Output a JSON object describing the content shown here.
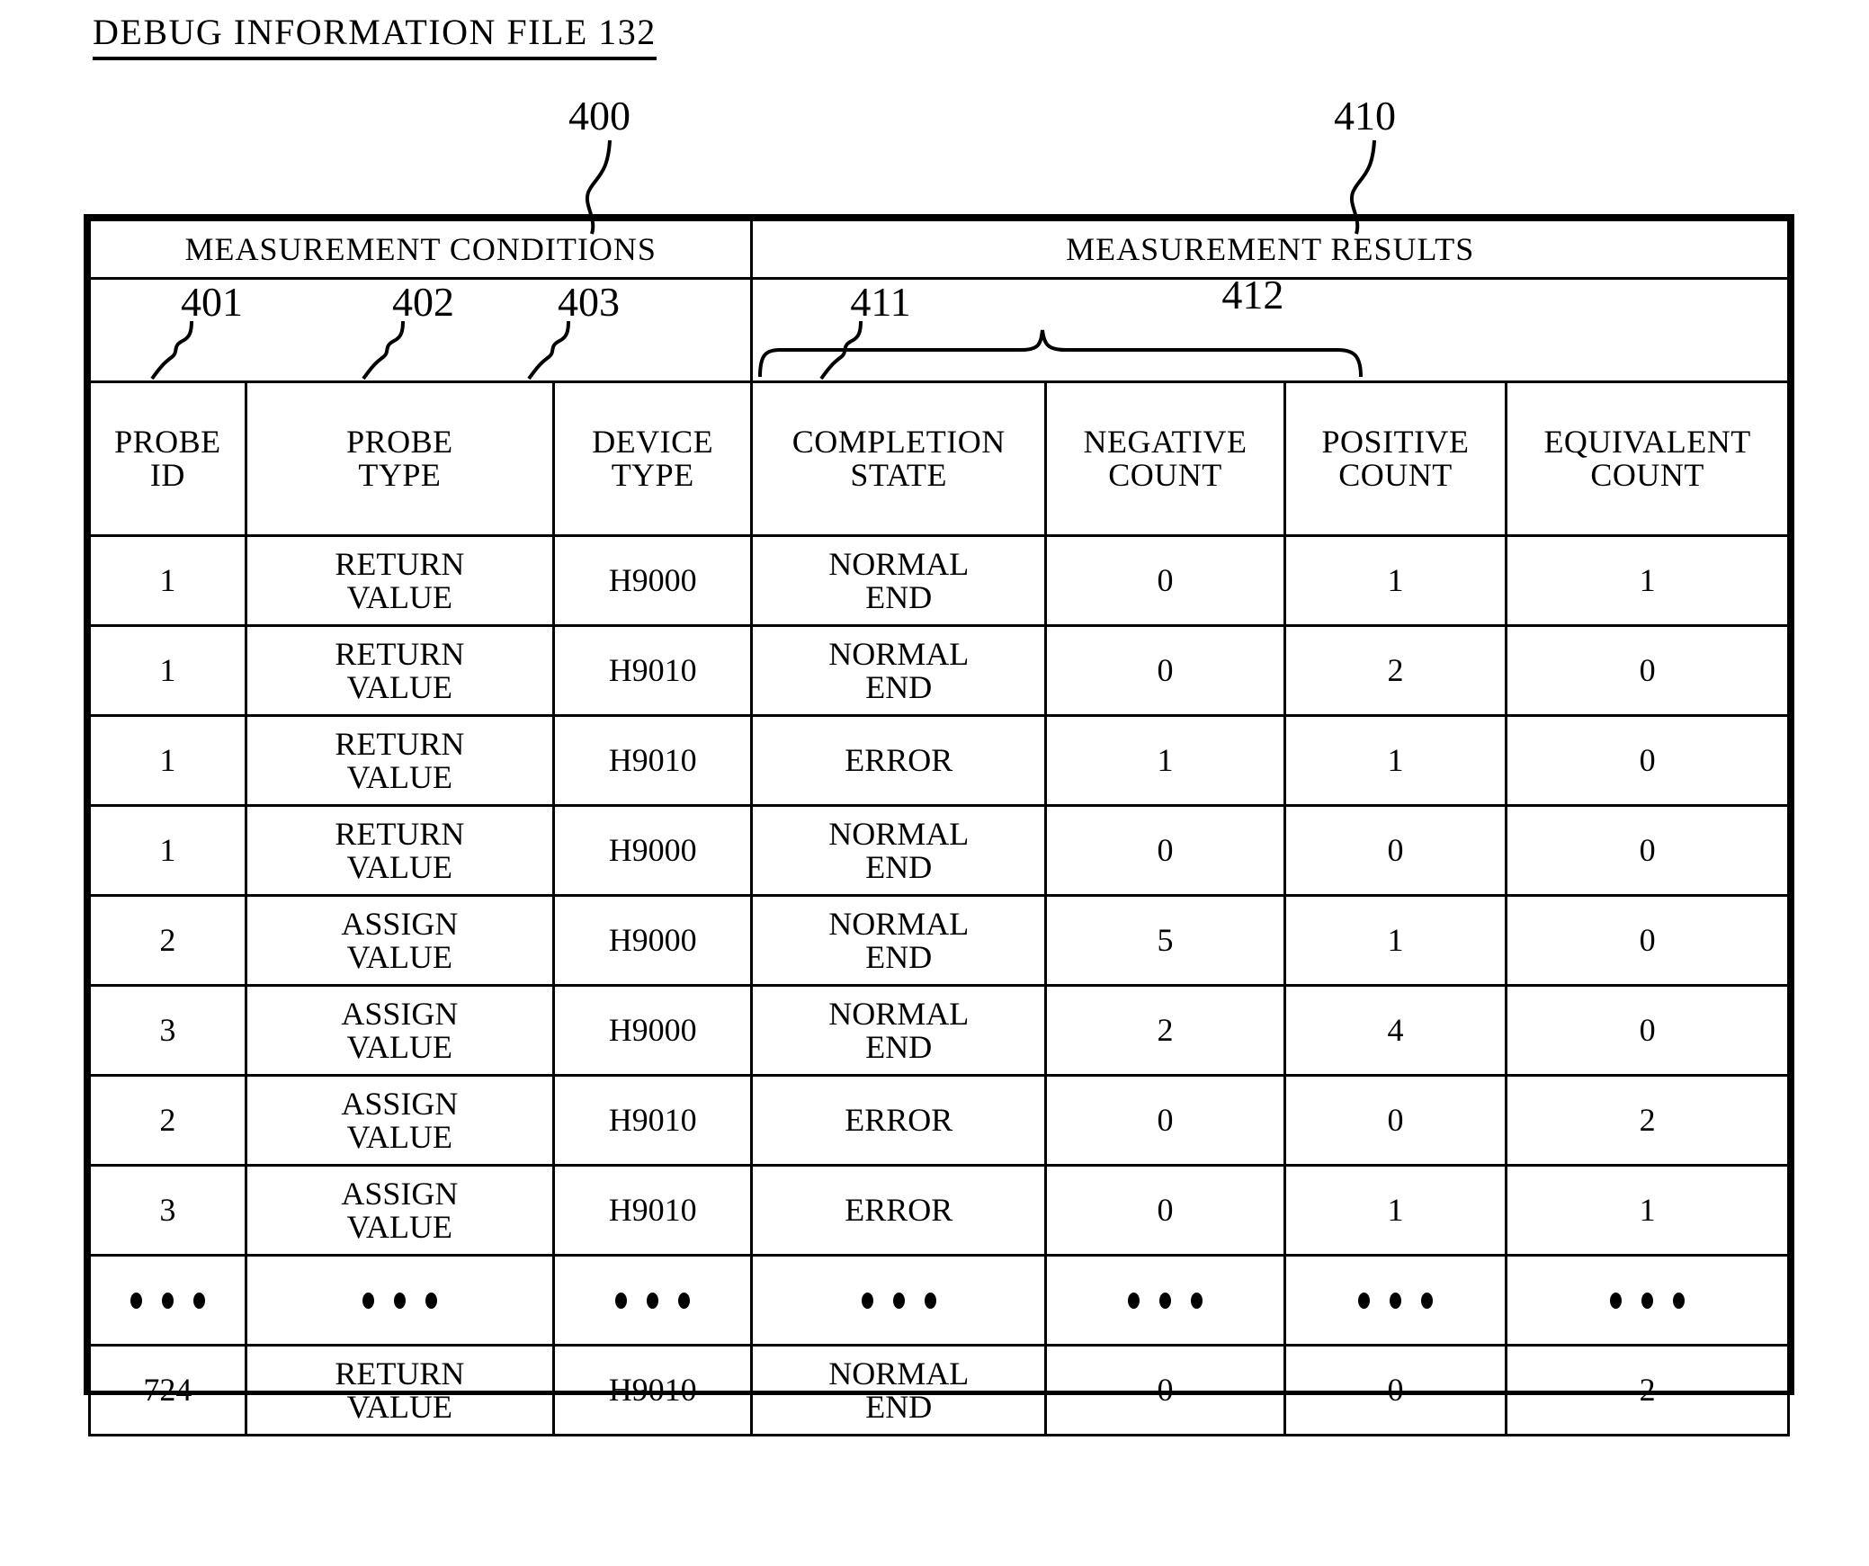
{
  "figure": {
    "title": "DEBUG INFORMATION FILE 132",
    "callouts": {
      "table": "400",
      "results": "410",
      "probe_id": "401",
      "probe_type": "402",
      "device_type": "403",
      "completion_state": "411",
      "counts_group": "412"
    }
  },
  "table": {
    "group_headers": [
      {
        "label": "MEASUREMENT CONDITIONS",
        "span": 3
      },
      {
        "label": "MEASUREMENT RESULTS",
        "span": 4
      }
    ],
    "columns": [
      {
        "key": "probe_id",
        "line1": "PROBE",
        "line2": "ID"
      },
      {
        "key": "probe_type",
        "line1": "PROBE",
        "line2": "TYPE"
      },
      {
        "key": "device_type",
        "line1": "DEVICE",
        "line2": "TYPE"
      },
      {
        "key": "completion_state",
        "line1": "COMPLETION",
        "line2": "STATE"
      },
      {
        "key": "negative_count",
        "line1": "NEGATIVE",
        "line2": "COUNT"
      },
      {
        "key": "positive_count",
        "line1": "POSITIVE",
        "line2": "COUNT"
      },
      {
        "key": "equivalent_count",
        "line1": "EQUIVALENT",
        "line2": "COUNT"
      }
    ],
    "ellipsis_glyph": "• • •",
    "rows": [
      {
        "probe_id": "1",
        "probe_type_l1": "RETURN",
        "probe_type_l2": "VALUE",
        "device_type": "H9000",
        "state_l1": "NORMAL",
        "state_l2": "END",
        "negative_count": "0",
        "positive_count": "1",
        "equivalent_count": "1"
      },
      {
        "probe_id": "1",
        "probe_type_l1": "RETURN",
        "probe_type_l2": "VALUE",
        "device_type": "H9010",
        "state_l1": "NORMAL",
        "state_l2": "END",
        "negative_count": "0",
        "positive_count": "2",
        "equivalent_count": "0"
      },
      {
        "probe_id": "1",
        "probe_type_l1": "RETURN",
        "probe_type_l2": "VALUE",
        "device_type": "H9010",
        "state_l1": "ERROR",
        "state_l2": "",
        "negative_count": "1",
        "positive_count": "1",
        "equivalent_count": "0"
      },
      {
        "probe_id": "1",
        "probe_type_l1": "RETURN",
        "probe_type_l2": "VALUE",
        "device_type": "H9000",
        "state_l1": "NORMAL",
        "state_l2": "END",
        "negative_count": "0",
        "positive_count": "0",
        "equivalent_count": "0"
      },
      {
        "probe_id": "2",
        "probe_type_l1": "ASSIGN",
        "probe_type_l2": "VALUE",
        "device_type": "H9000",
        "state_l1": "NORMAL",
        "state_l2": "END",
        "negative_count": "5",
        "positive_count": "1",
        "equivalent_count": "0"
      },
      {
        "probe_id": "3",
        "probe_type_l1": "ASSIGN",
        "probe_type_l2": "VALUE",
        "device_type": "H9000",
        "state_l1": "NORMAL",
        "state_l2": "END",
        "negative_count": "2",
        "positive_count": "4",
        "equivalent_count": "0"
      },
      {
        "probe_id": "2",
        "probe_type_l1": "ASSIGN",
        "probe_type_l2": "VALUE",
        "device_type": "H9010",
        "state_l1": "ERROR",
        "state_l2": "",
        "negative_count": "0",
        "positive_count": "0",
        "equivalent_count": "2"
      },
      {
        "probe_id": "3",
        "probe_type_l1": "ASSIGN",
        "probe_type_l2": "VALUE",
        "device_type": "H9010",
        "state_l1": "ERROR",
        "state_l2": "",
        "negative_count": "0",
        "positive_count": "1",
        "equivalent_count": "1"
      },
      {
        "is_ellipsis": true
      },
      {
        "probe_id": "724",
        "probe_type_l1": "RETURN",
        "probe_type_l2": "VALUE",
        "device_type": "H9010",
        "state_l1": "NORMAL",
        "state_l2": "END",
        "negative_count": "0",
        "positive_count": "0",
        "equivalent_count": "2"
      }
    ]
  }
}
